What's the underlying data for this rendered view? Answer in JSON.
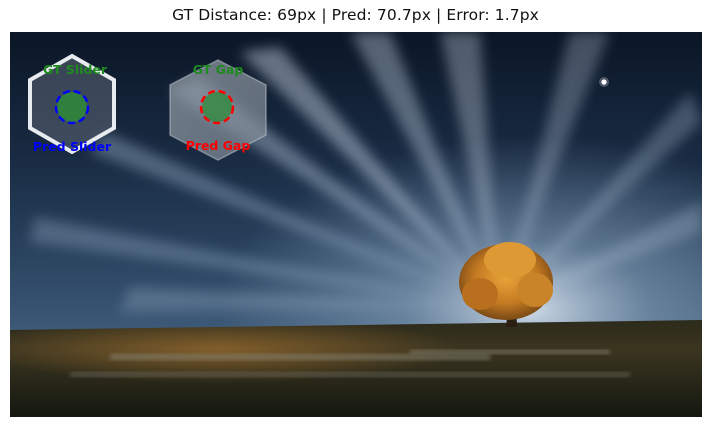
{
  "figure": {
    "title": "GT Distance: 69px | Pred: 70.7px | Error: 1.7px"
  },
  "labels": {
    "gt_slider": "GT Slider",
    "pred_slider": "Pred Slider",
    "gt_gap": "GT Gap",
    "pred_gap": "Pred Gap"
  },
  "colors": {
    "gt": "#1f8a1f",
    "pred_slider": "#0000ff",
    "pred_gap": "#ff0000",
    "gt_fill": "#2e8b3a"
  }
}
